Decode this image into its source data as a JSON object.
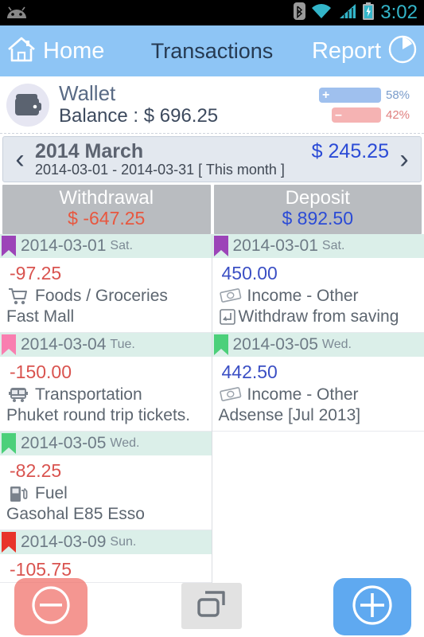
{
  "statusbar": {
    "clock": "3:02",
    "icons": [
      "bluetooth-icon",
      "wifi-icon",
      "cellular-signal-icon",
      "battery-charging-icon"
    ]
  },
  "topnav": {
    "home_label": "Home",
    "home_icon": "home-icon",
    "title": "Transactions",
    "report_label": "Report",
    "report_icon": "pie-chart-icon",
    "bg_color": "#8ec5f5"
  },
  "wallet": {
    "icon": "wallet-icon",
    "name": "Wallet",
    "balance": "Balance : $ 696.25",
    "positive_pct": "58%",
    "negative_pct": "42%",
    "positive_sign": "+",
    "negative_sign": "–",
    "positive_color": "#9fc0ee",
    "negative_color": "#f5b3b3"
  },
  "monthbar": {
    "prev_icon": "chevron-left-icon",
    "next_icon": "chevron-right-icon",
    "title": "2014 March",
    "amount": "$ 245.25",
    "range": "2014-03-01 - 2014-03-31 [ This month ]"
  },
  "summary": {
    "withdrawal_label": "Withdrawal",
    "withdrawal_amount": "$ -647.25",
    "deposit_label": "Deposit",
    "deposit_amount": "$ 892.50",
    "withdrawal_color": "#e8573f",
    "deposit_color": "#2b4bd6"
  },
  "transactions": {
    "withdrawals": [
      {
        "date": "2014-03-01",
        "dow": "Sat.",
        "bookmark_color": "#9c44b8",
        "amount": "-97.25",
        "category": "Foods / Groceries",
        "category_icon": "shopping-cart-icon",
        "note": "Fast Mall"
      },
      {
        "date": "2014-03-04",
        "dow": "Tue.",
        "bookmark_color": "#f97eb0",
        "amount": "-150.00",
        "category": "Transportation",
        "category_icon": "bus-icon",
        "note": "Phuket round trip tickets."
      },
      {
        "date": "2014-03-05",
        "dow": "Wed.",
        "bookmark_color": "#4cd07a",
        "amount": "-82.25",
        "category": "Fuel",
        "category_icon": "fuel-pump-icon",
        "note": "Gasohal E85 Esso"
      },
      {
        "date": "2014-03-09",
        "dow": "Sun.",
        "bookmark_color": "#e8342a",
        "amount": "-105.75",
        "category": "",
        "category_icon": "",
        "note": ""
      }
    ],
    "deposits": [
      {
        "date": "2014-03-01",
        "dow": "Sat.",
        "bookmark_color": "#9c44b8",
        "amount": "450.00",
        "category": "Income - Other",
        "category_icon": "banknote-icon",
        "note": "Withdraw from saving",
        "note_icon": "transfer-in-icon"
      },
      {
        "date": "2014-03-05",
        "dow": "Wed.",
        "bookmark_color": "#4cd07a",
        "amount": "442.50",
        "category": "Income - Other",
        "category_icon": "banknote-icon",
        "note": "Adsense [Jul 2013]",
        "note_icon": ""
      }
    ]
  },
  "fab": {
    "minus_icon": "minus-circle-icon",
    "minus_color": "#f06e67",
    "window_icon": "multi-window-icon",
    "plus_icon": "plus-circle-icon",
    "plus_color": "#5fa9f0"
  }
}
